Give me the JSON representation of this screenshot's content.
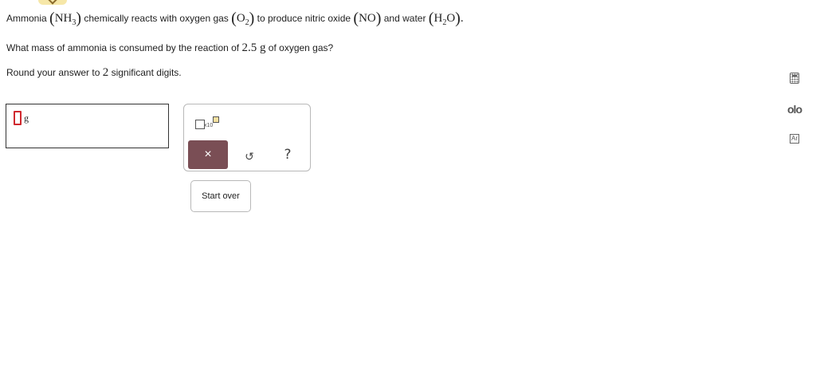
{
  "question": {
    "line1": {
      "t1": "Ammonia ",
      "nh3_base": "NH",
      "nh3_sub": "3",
      "t2": " chemically reacts with oxygen gas ",
      "o2_base": "O",
      "o2_sub": "2",
      "t3": " to produce nitric oxide ",
      "no": "NO",
      "t4": " and water ",
      "h2o_h": "H",
      "h2o_sub": "2",
      "h2o_o": "O",
      "end": "."
    },
    "line2": {
      "t1": "What mass of ammonia is consumed by the reaction of ",
      "mass": "2.5",
      "unit": " g",
      "t2": " of oxygen gas?"
    },
    "line3": {
      "t1": "Round your answer to ",
      "digits": "2",
      "t2": " significant digits."
    }
  },
  "answer": {
    "value": "",
    "unit": "g"
  },
  "palette": {
    "sci_x10": "x10",
    "clear": "×",
    "undo": "↺",
    "help": "?"
  },
  "start_over_label": "Start over",
  "side_tools": {
    "chart_label": "olo",
    "periodic_label": "Ar"
  },
  "colors": {
    "clear_button": "#7a4e55",
    "cursor": "#d0282e",
    "tab": "#f6e7a8"
  }
}
